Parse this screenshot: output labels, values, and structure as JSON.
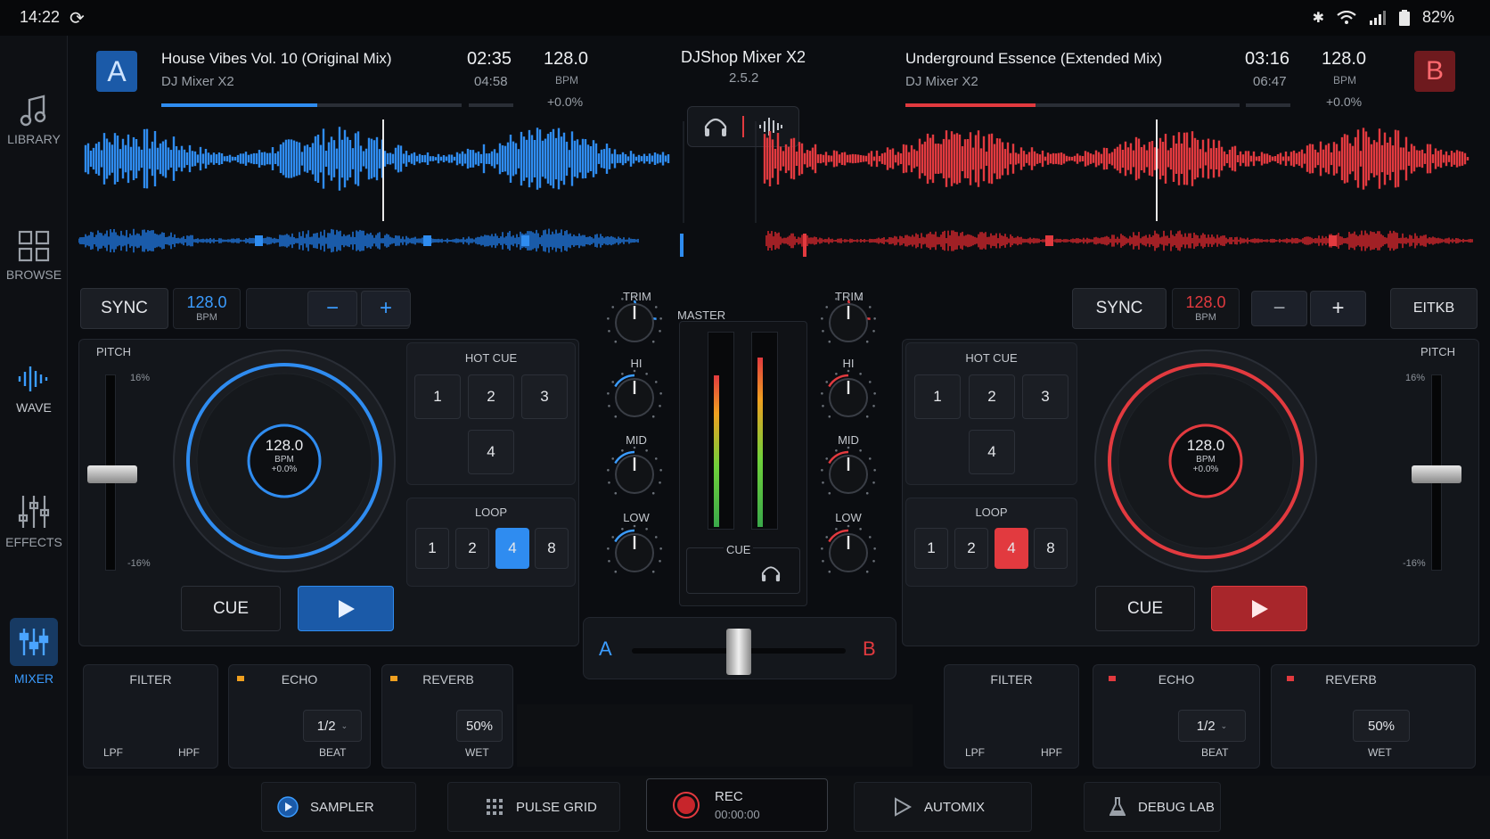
{
  "status": {
    "time": "14:22",
    "battery": "82%"
  },
  "sidebar": [
    {
      "label": "LIBRARY",
      "icon": "music-note-icon"
    },
    {
      "label": "BROWSE",
      "icon": "grid-icon"
    },
    {
      "label": "WAVE",
      "icon": "waveform-icon"
    },
    {
      "label": "EFFECTS",
      "icon": "sliders-icon"
    },
    {
      "label": "MIXER",
      "icon": "mixer-icon",
      "active": true
    }
  ],
  "app": {
    "title": "DJShop Mixer X2",
    "version": "2.5.2"
  },
  "deckA": {
    "letter": "A",
    "track": "House Vibes Vol. 10 (Original Mix)",
    "artist": "DJ Mixer X2",
    "elapsed": "02:35",
    "total": "04:58",
    "bpm": "128.0",
    "bpm_label": "BPM",
    "pitch": "+0.0%",
    "progress": 0.52,
    "sync": "SYNC",
    "pitch_label": "PITCH",
    "pitch_top": "16%",
    "pitch_bottom": "-16%",
    "minus": "−",
    "plus": "+",
    "hotcue_title": "HOT CUE",
    "hotcues": [
      "1",
      "2",
      "3",
      "4"
    ],
    "loop_title": "LOOP",
    "loops": [
      "1",
      "2",
      "4",
      "8"
    ],
    "active_loop": 2,
    "cue": "CUE",
    "color": "#2f8cf0"
  },
  "deckB": {
    "letter": "B",
    "track": "Underground Essence (Extended Mix)",
    "artist": "DJ Mixer X2",
    "elapsed": "03:16",
    "total": "06:47",
    "bpm": "128.0",
    "bpm_label": "BPM",
    "pitch": "+0.0%",
    "progress": 0.39,
    "sync": "SYNC",
    "extra": "ΕΙΤΚΒ",
    "pitch_label": "PITCH",
    "pitch_top": "16%",
    "pitch_bottom": "-16%",
    "minus": "−",
    "plus": "+",
    "hotcue_title": "HOT CUE",
    "hotcues": [
      "1",
      "2",
      "3",
      "4"
    ],
    "loop_title": "LOOP",
    "loops": [
      "1",
      "2",
      "4",
      "8"
    ],
    "active_loop": 2,
    "cue": "CUE",
    "color": "#e23a3f"
  },
  "mixer": {
    "master": "MASTER",
    "cue": "CUE",
    "eq_labels": [
      "TRIM",
      "HI",
      "MID",
      "LOW"
    ],
    "crossfader": {
      "a": "A",
      "b": "B",
      "position": 0.5
    }
  },
  "fx": {
    "filter": "FILTER",
    "lpf": "LPF",
    "hpf": "HPF",
    "echo": "ECHO",
    "echo_value": "1/2",
    "beat": "BEAT",
    "reverb": "REVERB",
    "reverb_value": "50%",
    "wet": "WET"
  },
  "bottom": [
    {
      "label": "SAMPLER",
      "icon": "play-circle-icon"
    },
    {
      "label": "PULSE GRID",
      "icon": "grid-dots-icon"
    },
    {
      "label": "REC",
      "sub": "00:00:00",
      "icon": "record-icon"
    },
    {
      "label": "AUTOMIX",
      "icon": "play-outline-icon"
    },
    {
      "label": "DEBUG LAB",
      "icon": "flask-icon"
    }
  ]
}
